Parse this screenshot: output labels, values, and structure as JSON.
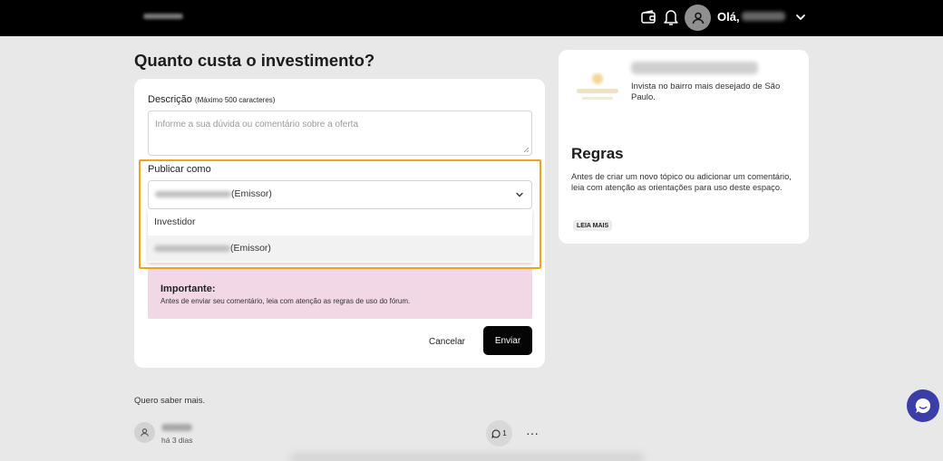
{
  "header": {
    "greeting": "Olá,",
    "icons": [
      "wallet-icon",
      "bell-icon",
      "user-icon",
      "chevron-down-icon"
    ]
  },
  "form": {
    "title": "Quanto custa o investimento?",
    "description_label": "Descrição",
    "description_hint": "(Máximo 500 caracteres)",
    "description_placeholder": "Informe a sua dúvida ou comentário sobre a oferta",
    "publish_label": "Publicar como",
    "selected_suffix": "(Emissor)",
    "options": [
      {
        "label": "Investidor"
      },
      {
        "label": "(Emissor)"
      }
    ],
    "notice_title": "Importante:",
    "notice_text": "Antes de enviar seu comentário, leia com atenção as regras de uso do fórum.",
    "cancel_label": "Cancelar",
    "send_label": "Enviar",
    "accent_color": "#f3a21f",
    "notice_color": "#f2d8e4"
  },
  "sidebar": {
    "offer_description": "Invista no bairro mais desejado de São Paulo.",
    "rules_title": "Regras",
    "rules_text": "Antes de criar um novo tópico ou adicionar um comentário, leia com atenção as orientações para uso deste espaço.",
    "read_more_label": "LEIA MAIS"
  },
  "comments": {
    "text": "Quero saber mais.",
    "time": "há 3 dias",
    "reply_count": "1",
    "more_label": "···"
  },
  "chat": {
    "icon": "chat-bubble-icon",
    "color": "#3a3ea6"
  }
}
